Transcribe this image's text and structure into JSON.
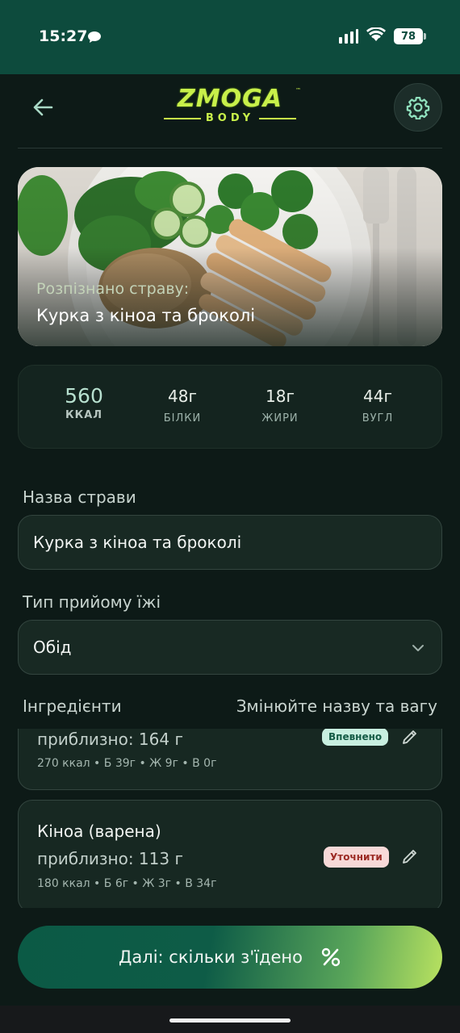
{
  "status_bar": {
    "time": "15:27",
    "battery": "78"
  },
  "header": {
    "logo_top": "ZMOGA",
    "logo_bottom": "BODY",
    "logo_tm": "™"
  },
  "hero": {
    "label": "Розпізнано страву:",
    "dish_name": "Курка з кіноа та броколі"
  },
  "macros": [
    {
      "value": "560",
      "label": "ККАЛ"
    },
    {
      "value": "48г",
      "label": "БІЛКИ"
    },
    {
      "value": "18г",
      "label": "ЖИРИ"
    },
    {
      "value": "44г",
      "label": "ВУГЛ"
    }
  ],
  "form": {
    "name_label": "Назва страви",
    "name_value": "Курка з кіноа та броколі",
    "meal_type_label": "Тип прийому їжі",
    "meal_type_value": "Обід"
  },
  "ingredients": {
    "title": "Інгредієнти",
    "hint": "Змінюйте назву та вагу",
    "items": [
      {
        "name": "",
        "weight": "приблизно: 164 г",
        "meta": "270 ккал • Б 39г • Ж 9г • В 0г",
        "badge": "Впевнено"
      },
      {
        "name": "Кіноа (варена)",
        "weight": "приблизно: 113 г",
        "meta": "180 ккал • Б 6г • Ж 3г • В 34г",
        "badge": "Уточнити"
      }
    ]
  },
  "next_button": {
    "label": "Далі: скільки з'їдено",
    "icon": "percent-icon"
  },
  "colors": {
    "status_bar": "#0d4b3d",
    "background": "#0d1a17",
    "accent_lime": "#c8f04a",
    "badge_ok": "#c8efe0",
    "badge_warn": "#f7d9d8"
  }
}
